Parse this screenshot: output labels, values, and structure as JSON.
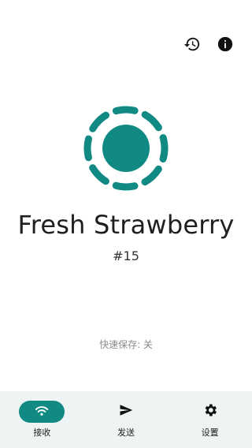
{
  "header": {
    "history_icon": "history-icon",
    "info_icon": "info-icon"
  },
  "device": {
    "name": "Fresh Strawberry",
    "number": "#15",
    "logo_color": "#118a83"
  },
  "status": {
    "quick_save": "快速保存: 关"
  },
  "nav": {
    "items": [
      {
        "label": "接收",
        "icon": "wifi-icon",
        "active": true
      },
      {
        "label": "发送",
        "icon": "send-icon",
        "active": false
      },
      {
        "label": "设置",
        "icon": "settings-icon",
        "active": false
      }
    ]
  },
  "colors": {
    "accent": "#118a83",
    "nav_background": "#eef4f3"
  }
}
